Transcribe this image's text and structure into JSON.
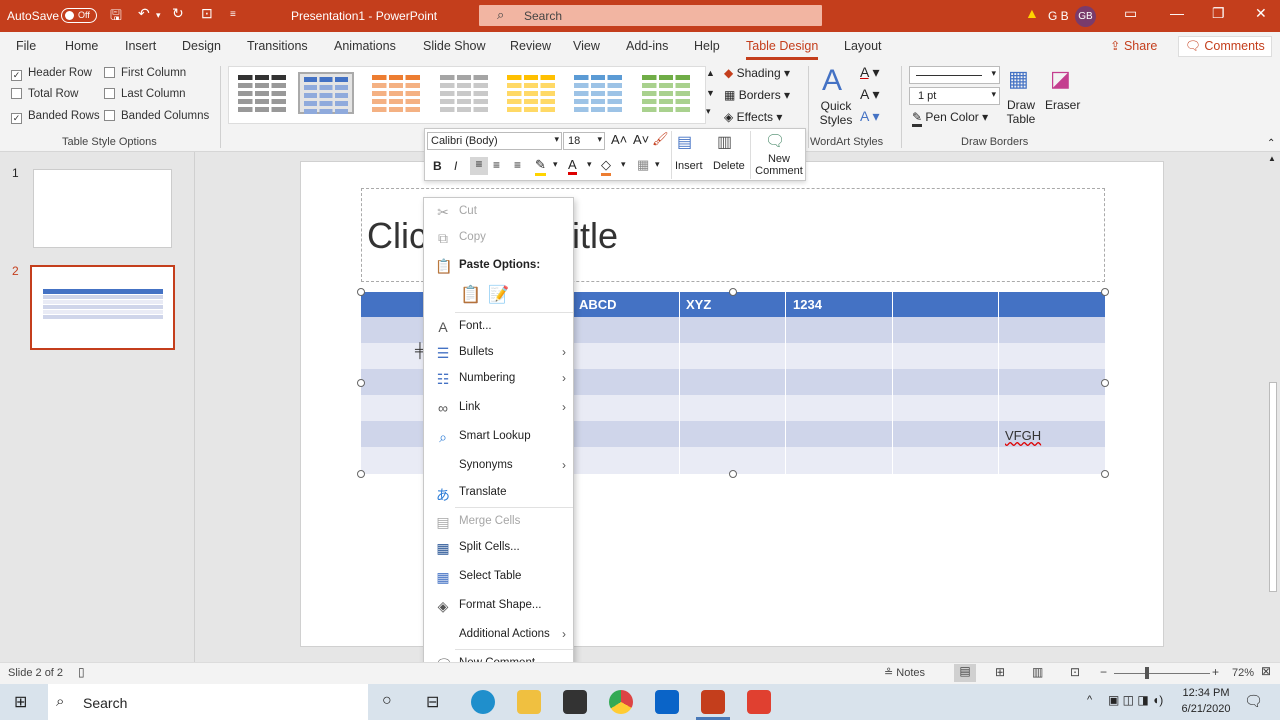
{
  "titlebar": {
    "autosave_label": "AutoSave",
    "autosave_state": "Off",
    "document_title": "Presentation1  -  PowerPoint",
    "search_placeholder": "Search",
    "user_name": "G B",
    "user_initials": "GB"
  },
  "tabs": [
    "File",
    "Home",
    "Insert",
    "Design",
    "Transitions",
    "Animations",
    "Slide Show",
    "Review",
    "View",
    "Add-ins",
    "Help",
    "Table Design",
    "Layout"
  ],
  "active_tab": "Table Design",
  "share_label": "Share",
  "comments_label": "Comments",
  "ribbon": {
    "table_style_options": {
      "header_row": "Header Row",
      "total_row": "Total Row",
      "banded_rows": "Banded Rows",
      "first_column": "First Column",
      "last_column": "Last Column",
      "banded_columns": "Banded Columns",
      "group_label": "Table Style Options"
    },
    "shading": "Shading",
    "borders": "Borders",
    "effects": "Effects",
    "quick_styles": "Quick Styles",
    "wordart_label": "WordArt Styles",
    "pen_weight": "1 pt",
    "pen_color": "Pen Color",
    "draw_table": "Draw Table",
    "eraser": "Eraser",
    "draw_borders_label": "Draw Borders"
  },
  "mini_toolbar": {
    "font": "Calibri (Body)",
    "size": "18",
    "insert": "Insert",
    "delete": "Delete",
    "new_comment": "New Comment"
  },
  "slides": [
    "1",
    "2"
  ],
  "slide": {
    "title_placeholder_left": "Clic",
    "title_placeholder_right": "itle",
    "header_cells": [
      "ABCD",
      "XYZ",
      "1234"
    ],
    "cell_vfgh": "VFGH"
  },
  "context_menu": {
    "cut": "Cut",
    "copy": "Copy",
    "paste_options": "Paste Options:",
    "font": "Font...",
    "bullets": "Bullets",
    "numbering": "Numbering",
    "link": "Link",
    "smart_lookup": "Smart Lookup",
    "synonyms": "Synonyms",
    "translate": "Translate",
    "merge_cells": "Merge Cells",
    "split_cells": "Split Cells...",
    "select_table": "Select Table",
    "format_shape": "Format Shape...",
    "additional_actions": "Additional Actions",
    "new_comment": "New Comment"
  },
  "status": {
    "slide_info": "Slide 2 of 2",
    "notes": "Notes",
    "zoom": "72%"
  },
  "taskbar": {
    "search": "Search",
    "time": "12:34 PM",
    "date": "6/21/2020"
  },
  "colors": {
    "accent": "#c43e1c",
    "table_header": "#4472c4",
    "band_dark": "#cfd5ea",
    "band_light": "#e9ebf5"
  }
}
